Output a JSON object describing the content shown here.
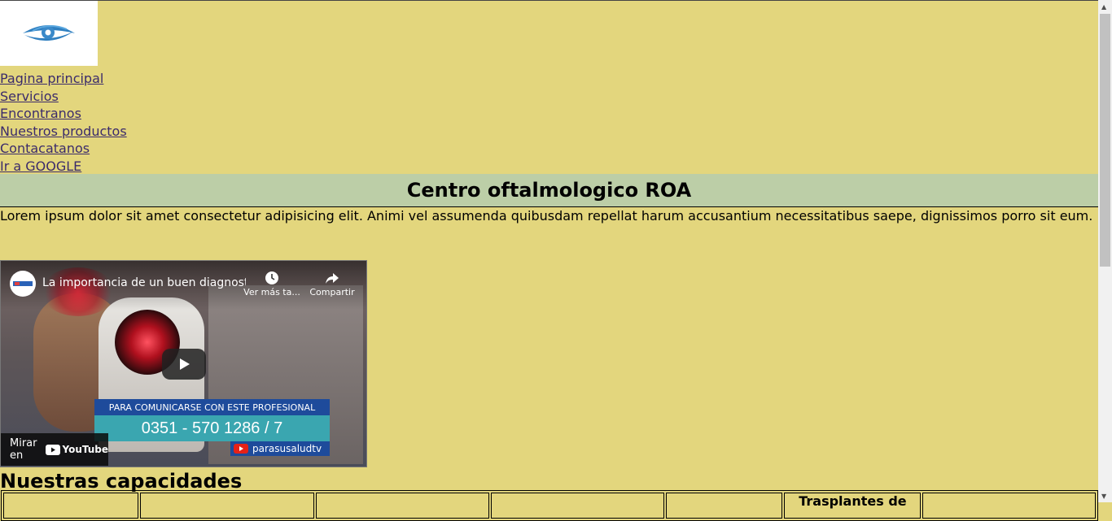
{
  "logo": {
    "icon": "eye-icon",
    "color": "#3a89c9"
  },
  "nav": {
    "items": [
      "Pagina principal",
      "Servicios",
      "Encontranos",
      "Nuestros productos",
      "Contacatanos",
      "Ir a GOOGLE"
    ]
  },
  "header": {
    "title": "Centro oftalmologico ROA"
  },
  "intro": {
    "text": "Lorem ipsum dolor sit amet consectetur adipisicing elit. Animi vel assumenda quibusdam repellat harum accusantium necessitatibus saepe, dignissimos porro sit eum."
  },
  "video": {
    "title": "La importancia de un buen diagnosti...",
    "watch_later_label": "Ver más ta...",
    "share_label": "Compartir",
    "banner_line1": "PARA COMUNICARSE CON ESTE PROFESIONAL",
    "banner_phone": "0351 - 570 1286 / 7",
    "banner_channel": "parasusaludtv",
    "watch_on_label": "Mirar en",
    "youtube_label": "YouTube"
  },
  "capabilities": {
    "heading": "Nuestras capacidades",
    "columns": [
      "",
      "",
      "",
      "",
      "",
      "Trasplantes de",
      ""
    ]
  },
  "colors": {
    "page_bg": "#e3d67d",
    "title_band": "#bccea7",
    "link": "#3b2b6b"
  }
}
